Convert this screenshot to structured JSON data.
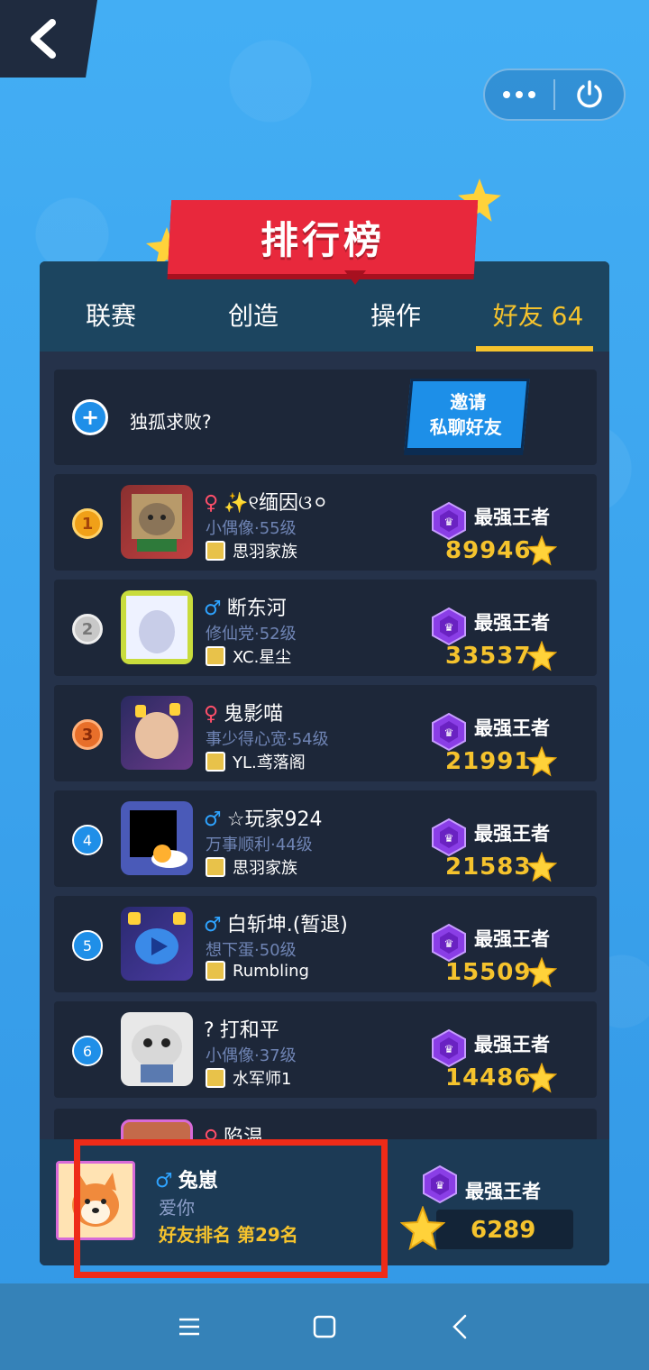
{
  "header": {
    "back_icon": "chevron-left-icon",
    "menu_icon": "more-dots-icon",
    "power_icon": "power-icon"
  },
  "title": "排行榜",
  "tabs": [
    {
      "label": "联赛",
      "active": false
    },
    {
      "label": "创造",
      "active": false
    },
    {
      "label": "操作",
      "active": false
    },
    {
      "label": "好友 64",
      "active": true
    }
  ],
  "invite": {
    "text": "独孤求败?",
    "button_line1": "邀请",
    "button_line2": "私聊好友"
  },
  "players": [
    {
      "rank": "1",
      "gender": "♀",
      "name": "✨୧缅因ଓ⚪",
      "title": "小偶像·55级",
      "clan": "思羽家族",
      "rank_title": "最强王者",
      "score": "89946"
    },
    {
      "rank": "2",
      "gender": "♂",
      "name": "断东河",
      "title": "修仙党·52级",
      "clan": "XC.星尘",
      "rank_title": "最强王者",
      "score": "33537"
    },
    {
      "rank": "3",
      "gender": "♀",
      "name": "鬼影喵",
      "title": "事少得心宽·54级",
      "clan": "YL.鸢落阁",
      "rank_title": "最强王者",
      "score": "21991"
    },
    {
      "rank": "4",
      "gender": "♂",
      "name": "☆玩家924",
      "title": "万事顺利·44级",
      "clan": "思羽家族",
      "rank_title": "最强王者",
      "score": "21583"
    },
    {
      "rank": "5",
      "gender": "♂",
      "name": "白斩坤.(暂退)",
      "title": "想下蛋·50级",
      "clan": "Rumbling",
      "rank_title": "最强王者",
      "score": "15509"
    },
    {
      "rank": "6",
      "gender": "?",
      "name": "打和平",
      "title": "小偶像·37级",
      "clan": "水军师1",
      "rank_title": "最强王者",
      "score": "14486"
    }
  ],
  "partial_row": {
    "gender": "♀",
    "name": "陷温"
  },
  "me": {
    "gender": "♂",
    "name": "兔崽",
    "signature": "爱你",
    "friend_rank": "好友排名 第29名",
    "rank_title": "最强王者",
    "score": "6289"
  },
  "colors": {
    "accent_gold": "#f5c32d",
    "banner_red": "#e8283c",
    "panel": "#25324a",
    "highlight": "#ee2b18"
  }
}
